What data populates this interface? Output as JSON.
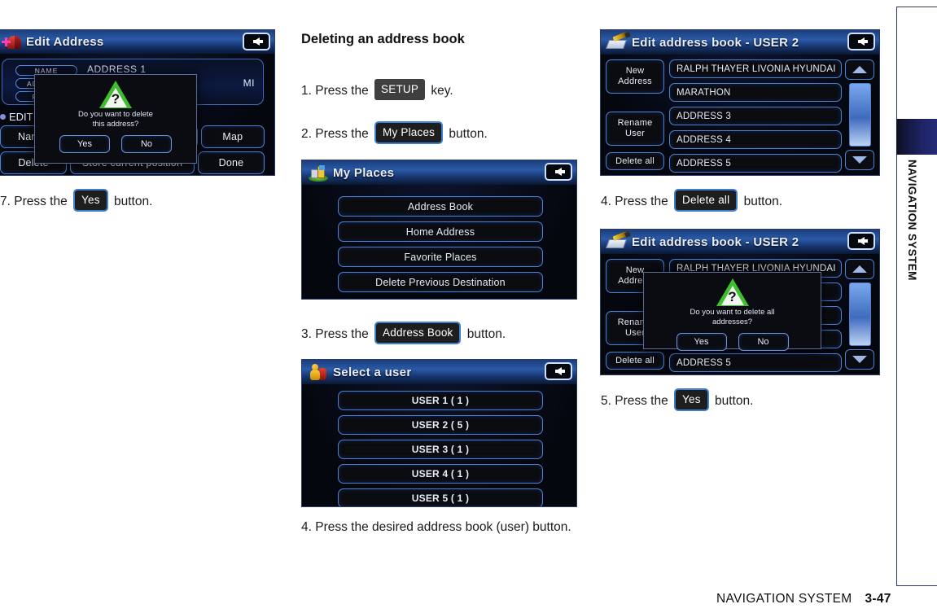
{
  "document": {
    "section_heading": "Deleting an address book",
    "footer_title": "NAVIGATION SYSTEM",
    "footer_page": "3-47",
    "side_tab_label": "NAVIGATION SYSTEM"
  },
  "steps": {
    "step7_left": {
      "prefix": "7. Press the",
      "key": "Yes",
      "suffix": "button."
    },
    "step1": {
      "prefix": "1. Press the",
      "key": "SETUP",
      "suffix": "key."
    },
    "step2": {
      "prefix": "2. Press the",
      "key": "My Places",
      "suffix": "button."
    },
    "step3": {
      "prefix": "3. Press the",
      "key": "Address Book",
      "suffix": "button."
    },
    "step4_mid": {
      "text": "4. Press the desired address book (user) button."
    },
    "step4_right": {
      "prefix": "4. Press the",
      "key": "Delete all",
      "suffix": "button."
    },
    "step5_right": {
      "prefix": "5. Press the",
      "key": "Yes",
      "suffix": "button."
    }
  },
  "screen_edit_address": {
    "title": "Edit Address",
    "header_icon": "mailbox-icon",
    "back_icon": "back-arrow-icon",
    "fields": [
      {
        "label": "NAME",
        "value": "ADDRESS 1"
      },
      {
        "label": "ADDRESS",
        "value": "MI"
      },
      {
        "label": "PHONE",
        "value": ""
      }
    ],
    "edit_label": "EDIT",
    "row1": [
      "Name",
      "Map"
    ],
    "row2": [
      "Delete",
      "Store current position",
      "Done"
    ],
    "dialog": {
      "icon": "warning-question-icon",
      "message_line1": "Do you want to delete",
      "message_line2": "this address?",
      "yes": "Yes",
      "no": "No"
    }
  },
  "screen_my_places": {
    "title": "My Places",
    "header_icon": "places-icon",
    "back_icon": "back-arrow-icon",
    "buttons": [
      "Address Book",
      "Home Address",
      "Favorite Places",
      "Delete Previous Destination"
    ]
  },
  "screen_select_user": {
    "title": "Select a user",
    "header_icon": "user-icon",
    "back_icon": "back-arrow-icon",
    "buttons": [
      "USER 1 ( 1 )",
      "USER 2 ( 5 )",
      "USER 3 ( 1 )",
      "USER 4 ( 1 )",
      "USER 5 ( 1 )"
    ]
  },
  "screen_edit_address_book": {
    "title": "Edit address book - USER 2",
    "header_icon": "address-book-icon",
    "back_icon": "back-arrow-icon",
    "side_buttons": {
      "new_address": "New\nAddress",
      "rename_user": "Rename\nUser",
      "delete_all": "Delete all"
    },
    "side_buttons_flat": {
      "new_address_l1": "New",
      "new_address_l2": "Address",
      "rename_user_l1": "Rename",
      "rename_user_l2": "User",
      "delete_all": "Delete all"
    },
    "entries": [
      "RALPH THAYER LIVONIA HYUNDAI",
      "MARATHON",
      "ADDRESS 3",
      "ADDRESS 4",
      "ADDRESS 5"
    ],
    "scroll_up_icon": "scroll-up-icon",
    "scroll_down_icon": "scroll-down-icon"
  },
  "screen_edit_address_book_dialog": {
    "title": "Edit address book - USER 2",
    "dialog": {
      "icon": "warning-question-icon",
      "message_line1": "Do you want to delete all",
      "message_line2": "addresses?",
      "yes": "Yes",
      "no": "No"
    }
  },
  "colors": {
    "screen_bg": "#05070f",
    "header_blue": "#2a5aa8",
    "button_border": "#4f7fd0",
    "tab_navy": "#252b77",
    "keycap_grey": "#3f3f3f"
  }
}
